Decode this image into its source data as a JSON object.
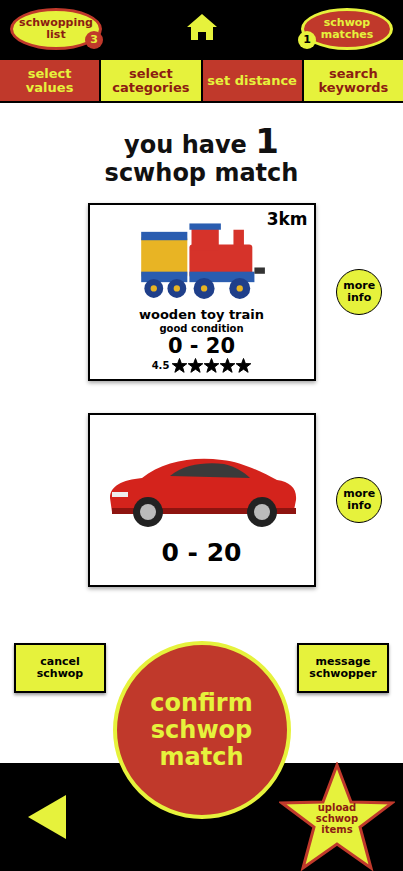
{
  "header": {
    "shopping_list": {
      "label": "schwopping list",
      "badge": "3"
    },
    "matches": {
      "label": "schwop matches",
      "badge": "1"
    }
  },
  "tabs": [
    {
      "label": "select values"
    },
    {
      "label": "select categories"
    },
    {
      "label": "set distance"
    },
    {
      "label": "search keywords"
    }
  ],
  "heading": {
    "prefix": "you have",
    "count": "1",
    "suffix": "scwhop match"
  },
  "items": [
    {
      "kind": "detailed",
      "distance": "3km",
      "title": "wooden toy train",
      "condition": "good condition",
      "value": "0 - 20",
      "rating": "4.5",
      "stars": 5,
      "more": "more info"
    },
    {
      "kind": "simple",
      "value": "0 - 20",
      "more": "more info"
    }
  ],
  "actions": {
    "cancel": "cancel schwop",
    "message": "message schwopper",
    "confirm": "confirm schwop match",
    "upload": "upload schwop items"
  }
}
